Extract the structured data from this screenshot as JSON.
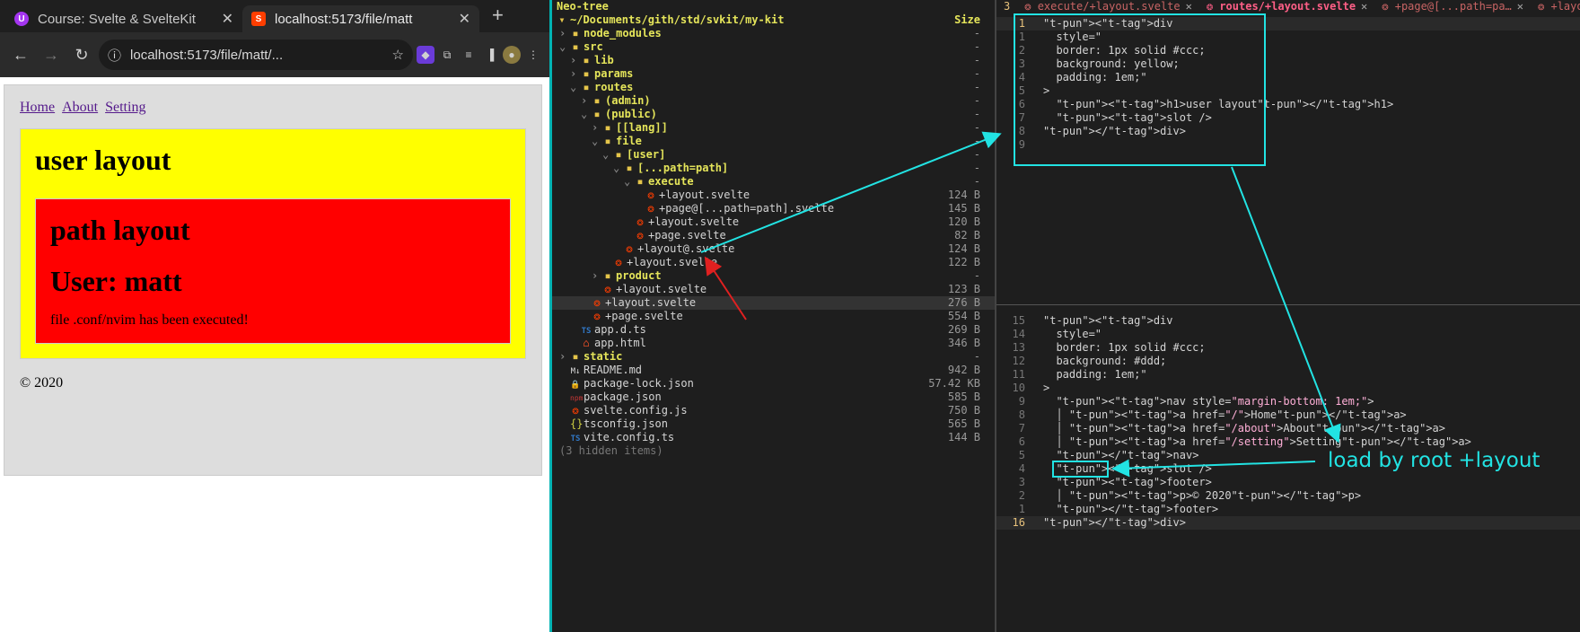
{
  "browser": {
    "tabs": [
      {
        "title": "Course: Svelte & SvelteKit",
        "favicon": "udemy-icon",
        "active": false
      },
      {
        "title": "localhost:5173/file/matt",
        "favicon": "svelte-icon",
        "active": true
      }
    ],
    "new_tab": "+",
    "url": "localhost:5173/file/matt/...",
    "page": {
      "nav": [
        "Home",
        "About",
        "Setting"
      ],
      "user_heading": "user layout",
      "path_heading": "path layout",
      "user_line": "User: matt",
      "message": "file .conf/nvim has been executed!",
      "footer": "© 2020"
    }
  },
  "neotree": {
    "title": "Neo-tree",
    "root": "~/Documents/gith/std/svkit/my-kit",
    "size_header": "Size",
    "rows": [
      {
        "name": "node_modules",
        "kind": "dir",
        "depth": 0,
        "open": false,
        "size": "-"
      },
      {
        "name": "src",
        "kind": "dir",
        "depth": 0,
        "open": true,
        "size": "-"
      },
      {
        "name": "lib",
        "kind": "dir",
        "depth": 1,
        "open": false,
        "size": "-"
      },
      {
        "name": "params",
        "kind": "dir",
        "depth": 1,
        "open": false,
        "size": "-"
      },
      {
        "name": "routes",
        "kind": "dir",
        "depth": 1,
        "open": true,
        "size": "-"
      },
      {
        "name": "(admin)",
        "kind": "dir",
        "depth": 2,
        "open": false,
        "size": "-"
      },
      {
        "name": "(public)",
        "kind": "dir",
        "depth": 2,
        "open": true,
        "size": "-"
      },
      {
        "name": "[[lang]]",
        "kind": "dir",
        "depth": 3,
        "open": false,
        "size": "-"
      },
      {
        "name": "file",
        "kind": "dir",
        "depth": 3,
        "open": true,
        "size": "-"
      },
      {
        "name": "[user]",
        "kind": "dir",
        "depth": 4,
        "open": true,
        "size": "-"
      },
      {
        "name": "[...path=path]",
        "kind": "dir",
        "depth": 5,
        "open": true,
        "size": "-"
      },
      {
        "name": "execute",
        "kind": "dir",
        "depth": 6,
        "open": true,
        "size": "-"
      },
      {
        "name": "+layout.svelte",
        "kind": "svelte",
        "depth": 7,
        "size": "124 B"
      },
      {
        "name": "+page@[...path=path].svelte",
        "kind": "svelte",
        "depth": 7,
        "size": "145 B"
      },
      {
        "name": "+layout.svelte",
        "kind": "svelte",
        "depth": 6,
        "size": "120 B"
      },
      {
        "name": "+page.svelte",
        "kind": "svelte",
        "depth": 6,
        "size": "82 B"
      },
      {
        "name": "+layout@.svelte",
        "kind": "svelte",
        "depth": 5,
        "size": "124 B"
      },
      {
        "name": "+layout.svelte",
        "kind": "svelte",
        "depth": 4,
        "size": "122 B"
      },
      {
        "name": "product",
        "kind": "dir",
        "depth": 3,
        "open": false,
        "size": "-"
      },
      {
        "name": "+layout.svelte",
        "kind": "svelte",
        "depth": 3,
        "size": "123 B"
      },
      {
        "name": "+layout.svelte",
        "kind": "svelte",
        "depth": 2,
        "size": "276 B",
        "selected": true
      },
      {
        "name": "+page.svelte",
        "kind": "svelte",
        "depth": 2,
        "size": "554 B"
      },
      {
        "name": "app.d.ts",
        "kind": "ts",
        "depth": 1,
        "size": "269 B"
      },
      {
        "name": "app.html",
        "kind": "html",
        "depth": 1,
        "size": "346 B"
      },
      {
        "name": "static",
        "kind": "dir",
        "depth": 0,
        "open": false,
        "size": "-"
      },
      {
        "name": "README.md",
        "kind": "md",
        "depth": 0,
        "size": "942 B"
      },
      {
        "name": "package-lock.json",
        "kind": "lock",
        "depth": 0,
        "size": "57.42 KB"
      },
      {
        "name": "package.json",
        "kind": "npm",
        "depth": 0,
        "size": "585 B"
      },
      {
        "name": "svelte.config.js",
        "kind": "svelte",
        "depth": 0,
        "size": "750 B"
      },
      {
        "name": "tsconfig.json",
        "kind": "json",
        "depth": 0,
        "size": "565 B"
      },
      {
        "name": "vite.config.ts",
        "kind": "ts",
        "depth": 0,
        "size": "144 B"
      },
      {
        "name": "(3 hidden items)",
        "kind": "hidden",
        "depth": 0,
        "size": ""
      }
    ]
  },
  "editor": {
    "tab_count": "3",
    "tabs": [
      {
        "label": "execute/+layout.svelte",
        "active": false
      },
      {
        "label": "routes/+layout.svelte",
        "active": true
      },
      {
        "label": "+page@[...path=pa…",
        "active": false
      },
      {
        "label": "+layout.svelte",
        "active": false
      }
    ],
    "top_lines": [
      {
        "n": "1",
        "cur": true,
        "code": "<div"
      },
      {
        "n": "1",
        "code": "  style=\""
      },
      {
        "n": "2",
        "code": "  border: 1px solid #ccc;"
      },
      {
        "n": "3",
        "code": "  background: yellow;"
      },
      {
        "n": "4",
        "code": "  padding: 1em;\""
      },
      {
        "n": "5",
        "code": ">"
      },
      {
        "n": "6",
        "code": "  <h1>user layout</h1>"
      },
      {
        "n": "7",
        "code": "  <slot />"
      },
      {
        "n": "8",
        "code": "</div>"
      },
      {
        "n": "9",
        "code": ""
      }
    ],
    "bottom_lines": [
      {
        "n": "15",
        "code": "<div"
      },
      {
        "n": "14",
        "code": "  style=\""
      },
      {
        "n": "13",
        "code": "  border: 1px solid #ccc;"
      },
      {
        "n": "12",
        "code": "  background: #ddd;"
      },
      {
        "n": "11",
        "code": "  padding: 1em;\""
      },
      {
        "n": "10",
        "code": ">"
      },
      {
        "n": "9",
        "code": "  <nav style=\"margin-bottom: 1em;\">"
      },
      {
        "n": "8",
        "code": "  │ <a href=\"/\">Home</a>"
      },
      {
        "n": "7",
        "code": "  │ <a href=\"/about\">About</a>"
      },
      {
        "n": "6",
        "code": "  │ <a href=\"/setting\">Setting</a>"
      },
      {
        "n": "5",
        "code": "  </nav>"
      },
      {
        "n": "4",
        "code": "  <slot />"
      },
      {
        "n": "3",
        "code": "  <footer>"
      },
      {
        "n": "2",
        "code": "  │ <p>© 2020</p>"
      },
      {
        "n": "1",
        "code": "  </footer>"
      },
      {
        "n": "16",
        "cur": true,
        "code": "</div>"
      }
    ]
  },
  "annotation": "load by root +layout",
  "colors": {
    "annotation": "#22e3e3",
    "arrow_red": "#e02020"
  }
}
